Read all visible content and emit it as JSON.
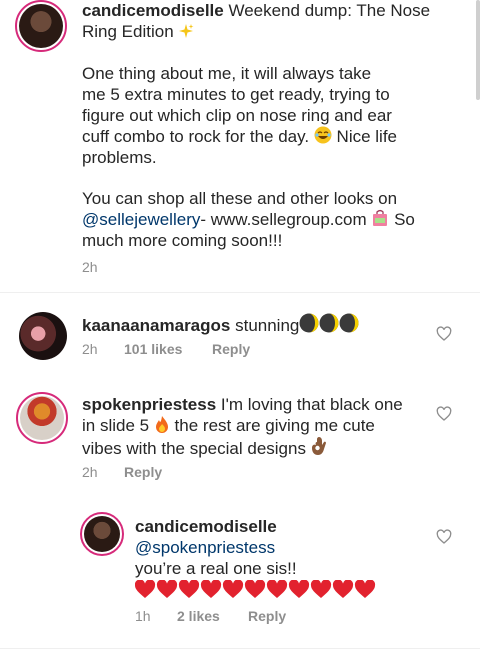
{
  "caption": {
    "username": "candicemodiselle",
    "line1_rest": " Weekend dump: The Nose",
    "line2": "Ring Edition",
    "para2_l1": "One thing about me, it will always take",
    "para2_l2": "me 5 extra minutes to get ready, trying to",
    "para2_l3": "figure out which clip on nose ring and ear",
    "para2_l4": "cuff combo to rock for the day. ",
    "para2_l4b": " Nice life",
    "para2_l5": "problems.",
    "para3_l1": "You can shop all these and other looks on",
    "mention": "@sellejewellery",
    "para3_l2_rest": "- www.sellegroup.com ",
    "para3_l2_end": " So",
    "para3_l3": "much more coming soon!!!",
    "time": "2h"
  },
  "comments": [
    {
      "username": "kaanaanamaragos",
      "text": " stunning",
      "time": "2h",
      "likes": "101 likes",
      "reply": "Reply"
    },
    {
      "username": "spokenpriestess",
      "text_l1": " I'm loving that black one",
      "text_l2a": "in slide 5 ",
      "text_l2b": " the rest are giving me cute",
      "text_l3": "vibes with the special designs ",
      "time": "2h",
      "reply": "Reply"
    },
    {
      "username": "candicemodiselle",
      "mention": "@spokenpriestess",
      "text": "you’re a real one sis!!",
      "time": "1h",
      "likes": "2 likes",
      "reply": "Reply"
    }
  ],
  "colors": {
    "mention": "#00376b",
    "story_ring": "#d62a7a",
    "meta": "#8e8e8e"
  },
  "icons": [
    "heart-outline-icon",
    "sparkles-emoji",
    "laughing-emoji",
    "shopping-bag-emoji",
    "moon-emoji",
    "fire-emoji",
    "ok-hand-emoji",
    "red-heart-emoji"
  ]
}
